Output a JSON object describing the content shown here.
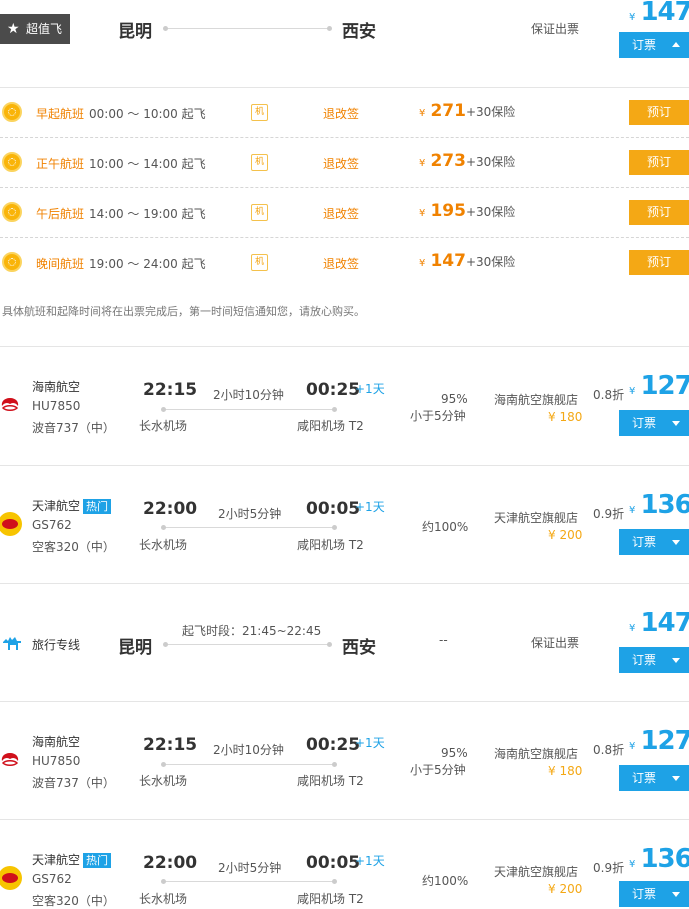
{
  "top": {
    "badge": "超值飞",
    "from": "昆明",
    "to": "西安",
    "guarantee": "保证出票",
    "yen": "¥",
    "price": "147",
    "btn": "订票"
  },
  "slots": [
    {
      "name": "早起航班",
      "time": "00:00 ～ 10:00 起飞",
      "ji": "机",
      "change": "退改签",
      "yen": "¥",
      "price": "271",
      "ins": "+30保险",
      "btn": "预订"
    },
    {
      "name": "正午航班",
      "time": "10:00 ～ 14:00 起飞",
      "ji": "机",
      "change": "退改签",
      "yen": "¥",
      "price": "273",
      "ins": "+30保险",
      "btn": "预订"
    },
    {
      "name": "午后航班",
      "time": "14:00 ～ 19:00 起飞",
      "ji": "机",
      "change": "退改签",
      "yen": "¥",
      "price": "195",
      "ins": "+30保险",
      "btn": "预订"
    },
    {
      "name": "晚间航班",
      "time": "19:00 ～ 24:00 起飞",
      "ji": "机",
      "change": "退改签",
      "yen": "¥",
      "price": "147",
      "ins": "+30保险",
      "btn": "预订"
    }
  ],
  "note": "具体航班和起降时间将在出票完成后，第一时间短信通知您，请放心购买。",
  "flights": [
    {
      "airline": "海南航空",
      "hot": "",
      "fno": "HU7850",
      "plane": "波音737（中）",
      "dep": "22:15",
      "dur": "2小时10分钟",
      "arr": "00:25",
      "plus": "+1天",
      "depap": "长水机场",
      "arrap": "咸阳机场 T2",
      "rate1": "95%",
      "rate2": "小于5分钟",
      "shop": "海南航空旗舰店",
      "orig": "¥ 180",
      "disc": "0.8折",
      "yen": "¥",
      "price": "127",
      "btn": "订票"
    },
    {
      "airline": "天津航空",
      "hot": "热门",
      "fno": "GS762",
      "plane": "空客320（中）",
      "dep": "22:00",
      "dur": "2小时5分钟",
      "arr": "00:05",
      "plus": "+1天",
      "depap": "长水机场",
      "arrap": "咸阳机场 T2",
      "rate1": "约100%",
      "rate2": "",
      "shop": "天津航空旗舰店",
      "orig": "¥ 200",
      "disc": "0.9折",
      "yen": "¥",
      "price": "136",
      "btn": "订票"
    },
    {
      "airline": "海南航空",
      "hot": "",
      "fno": "HU7850",
      "plane": "波音737（中）",
      "dep": "22:15",
      "dur": "2小时10分钟",
      "arr": "00:25",
      "plus": "+1天",
      "depap": "长水机场",
      "arrap": "咸阳机场 T2",
      "rate1": "95%",
      "rate2": "小于5分钟",
      "shop": "海南航空旗舰店",
      "orig": "¥ 180",
      "disc": "0.8折",
      "yen": "¥",
      "price": "127",
      "btn": "订票"
    },
    {
      "airline": "天津航空",
      "hot": "热门",
      "fno": "GS762",
      "plane": "空客320（中）",
      "dep": "22:00",
      "dur": "2小时5分钟",
      "arr": "00:05",
      "plus": "+1天",
      "depap": "长水机场",
      "arrap": "咸阳机场 T2",
      "rate1": "约100%",
      "rate2": "",
      "shop": "天津航空旗舰店",
      "orig": "¥ 200",
      "disc": "0.9折",
      "yen": "¥",
      "price": "136",
      "btn": "订票"
    }
  ],
  "travel": {
    "label": "旅行专线",
    "from": "昆明",
    "to": "西安",
    "period": "起飞时段：21:45~22:45",
    "rate": "--",
    "guarantee": "保证出票",
    "yen": "¥",
    "price": "147",
    "btn": "订票"
  }
}
